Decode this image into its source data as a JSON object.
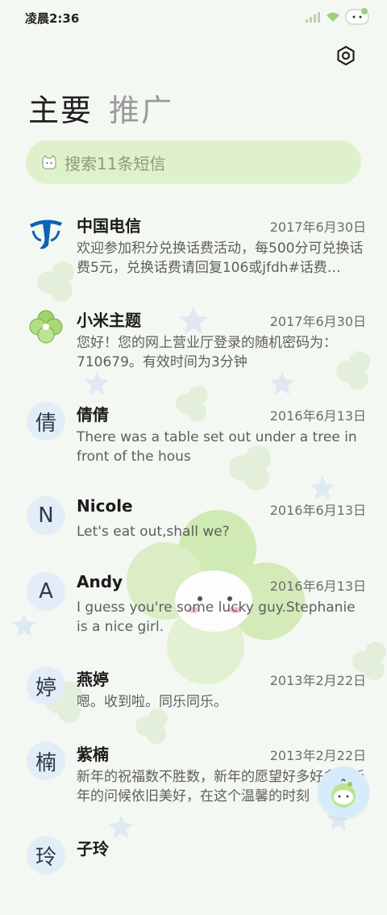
{
  "status_bar": {
    "time": "凌晨2:36"
  },
  "header": {
    "tabs": [
      {
        "label": "主要"
      },
      {
        "label": "推广"
      }
    ]
  },
  "search": {
    "placeholder": "搜索11条短信"
  },
  "messages": [
    {
      "name": "中国电信",
      "date": "2017年6月30日",
      "preview": "欢迎参加积分兑换话费活动，每500分可兑换话费5元，兑换话费请回复106或jfdh#话费…",
      "avatar_icon": "china-telecom-logo"
    },
    {
      "name": "小米主题",
      "date": "2017年6月30日",
      "preview": "您好！您的网上营业厅登录的随机密码为：710679。有效时间为3分钟",
      "avatar_icon": "clover-logo"
    },
    {
      "name": "倩倩",
      "date": "2016年6月13日",
      "preview": "There was a table set out under a tree in front of the hous",
      "avatar_letter": "倩"
    },
    {
      "name": "Nicole",
      "date": "2016年6月13日",
      "preview": "Let's eat out,shall we?",
      "avatar_letter": "N"
    },
    {
      "name": "Andy",
      "date": "2016年6月13日",
      "preview": "I guess you're some lucky guy.Stephanie is a nice girl.",
      "avatar_letter": "A"
    },
    {
      "name": "燕婷",
      "date": "2013年2月22日",
      "preview": "嗯。收到啦。同乐同乐。",
      "avatar_letter": "婷"
    },
    {
      "name": "紫楠",
      "date": "2013年2月22日",
      "preview": "新年的祝福数不胜数，新年的愿望好多好多，新年的问候依旧美好，在这个温馨的时刻",
      "avatar_letter": "楠"
    },
    {
      "name": "子玲",
      "date": "",
      "preview": "",
      "avatar_letter": "玲"
    }
  ],
  "colors": {
    "accent_green": "#dcf0c8",
    "avatar_bg": "#e3edf7",
    "telecom_blue": "#0a64b4",
    "clover_green": "#8fcf5a"
  }
}
